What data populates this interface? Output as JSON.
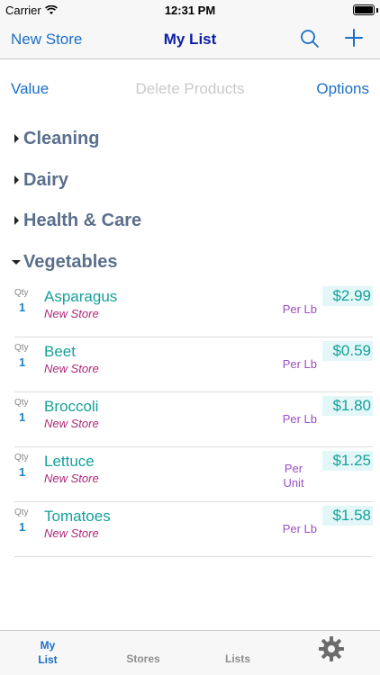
{
  "status_bar": {
    "carrier": "Carrier",
    "time": "12:31 PM",
    "battery_level": 1.0
  },
  "nav": {
    "left_button": "New Store",
    "title": "My List",
    "search_icon": "search-icon",
    "add_icon": "plus-icon"
  },
  "toolbar": {
    "value_label": "Value",
    "delete_label": "Delete Products",
    "options_label": "Options"
  },
  "categories": [
    {
      "label": "Cleaning",
      "expanded": false
    },
    {
      "label": "Dairy",
      "expanded": false
    },
    {
      "label": "Health & Care",
      "expanded": false
    },
    {
      "label": "Vegetables",
      "expanded": true
    }
  ],
  "products": [
    {
      "qty_label": "Qty",
      "qty": "1",
      "name": "Asparagus",
      "store": "New Store",
      "unit": "Per Lb",
      "price": "$2.99"
    },
    {
      "qty_label": "Qty",
      "qty": "1",
      "name": "Beet",
      "store": "New Store",
      "unit": "Per Lb",
      "price": "$0.59"
    },
    {
      "qty_label": "Qty",
      "qty": "1",
      "name": "Broccoli",
      "store": "New Store",
      "unit": "Per Lb",
      "price": "$1.80"
    },
    {
      "qty_label": "Qty",
      "qty": "1",
      "name": "Lettuce",
      "store": "New Store",
      "unit_line1": "Per",
      "unit_line2": "Unit",
      "price": "$1.25"
    },
    {
      "qty_label": "Qty",
      "qty": "1",
      "name": "Tomatoes",
      "store": "New Store",
      "unit": "Per Lb",
      "price": "$1.58"
    }
  ],
  "tabs": {
    "mylist_line1": "My",
    "mylist_line2": "List",
    "stores": "Stores",
    "lists": "Lists",
    "settings_icon": "gear-icon"
  },
  "colors": {
    "accent": "#1b6fc8",
    "title": "#0b1fa8",
    "category": "#5a6f8c",
    "product_name": "#16a09a",
    "store": "#b0277a",
    "unit": "#9c4fc4",
    "price_bg": "#e3f7f8"
  }
}
